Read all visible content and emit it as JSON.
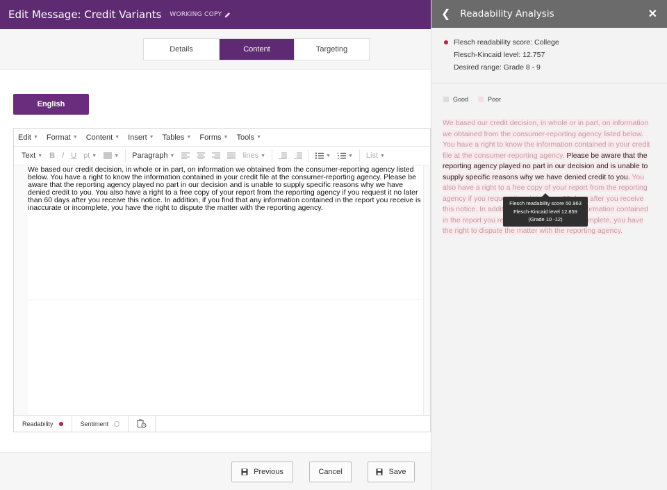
{
  "header": {
    "title": "Edit Message: Credit Variants",
    "badge": "WORKING COPY"
  },
  "tabs": [
    {
      "label": "Details"
    },
    {
      "label": "Content"
    },
    {
      "label": "Targeting"
    }
  ],
  "language_button": "English",
  "editor": {
    "menu": [
      "Edit",
      "Format",
      "Content",
      "Insert",
      "Tables",
      "Forms",
      "Tools"
    ],
    "toolbar": {
      "text": "Text",
      "bold": "B",
      "italic": "I",
      "underline": "U",
      "size": "pt",
      "paragraph": "Paragraph",
      "lines": "lines",
      "list": "List"
    },
    "body": "We based our credit decision, in whole or in part, on information we obtained from the consumer-reporting agency listed below. You have a right to know the information contained in your credit file at the consumer-reporting agency. Please be aware that the reporting agency played no part in our decision and is unable to supply specific reasons why we have denied credit to you. You also have a right to a free copy of your report from the reporting agency if you request it no later than 60 days after you receive this notice. In addition, if you find that any information contained in the report you receive is inaccurate or incomplete, you have the right to dispute the matter with the reporting agency.",
    "status": {
      "readability": "Readability",
      "sentiment": "Sentiment"
    }
  },
  "footer": {
    "previous": "Previous",
    "cancel": "Cancel",
    "save": "Save"
  },
  "panel": {
    "title": "Readability Analysis",
    "score": "Flesch readability score: College",
    "fk_level": "Flesch-Kincaid level: 12.757",
    "desired": "Desired range: Grade 8 - 9",
    "legend_good": "Good",
    "legend_poor": "Poor",
    "text_part1": "We based our credit decision, in whole or in part, on information we obtained from the consumer-reporting agency listed below. You have a right to know the information contained in your credit file at the consumer-reporting agency. ",
    "text_part2": "Please be aware that the reporting agency played no part in our decision and is unable to supply specific reasons why we have denied credit to you.",
    "text_part3": " You also have a right to a free copy of your report from the reporting agency if you request it no later than 60 days after you receive this notice. In addition, if you find that any information contained in the report you receive is inaccurate or incomplete, you have the right to dispute the matter with the reporting agency.",
    "tooltip": {
      "score": "Flesch readability score 50.963",
      "fk": "Flesch-Kincaid level 12.859",
      "grade": "(Grade 10 -12)"
    }
  },
  "colors": {
    "brand": "#5e2a71",
    "poor": "#fbeaed",
    "score_dot": "#b42244"
  }
}
